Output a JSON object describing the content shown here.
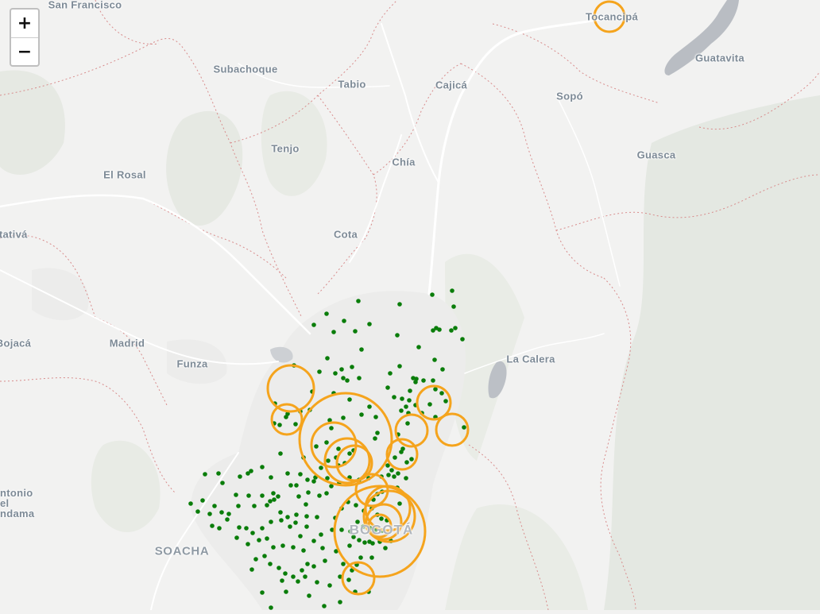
{
  "map": {
    "zoom_in_label": "+",
    "zoom_out_label": "−",
    "colors": {
      "background": "#f2f2f1",
      "terrain": "#e3e7e1",
      "water": "#b9bdc3",
      "road": "#ffffff",
      "boundary": "#d88c8c",
      "point": "#0a7d0a",
      "circle": "#f5a41d"
    },
    "labels": [
      {
        "id": "san-francisco",
        "text": "San Francisco",
        "kind": "town"
      },
      {
        "id": "tocancipa",
        "text": "Tocancipá",
        "kind": "town"
      },
      {
        "id": "guatavita",
        "text": "Guatavita",
        "kind": "town"
      },
      {
        "id": "subachoque",
        "text": "Subachoque",
        "kind": "town"
      },
      {
        "id": "tabio",
        "text": "Tabio",
        "kind": "town"
      },
      {
        "id": "cajica",
        "text": "Cajicá",
        "kind": "town"
      },
      {
        "id": "sopo",
        "text": "Sopó",
        "kind": "town"
      },
      {
        "id": "tenjo",
        "text": "Tenjo",
        "kind": "town"
      },
      {
        "id": "chia",
        "text": "Chía",
        "kind": "town"
      },
      {
        "id": "guasca",
        "text": "Guasca",
        "kind": "town"
      },
      {
        "id": "el-rosal",
        "text": "El Rosal",
        "kind": "town"
      },
      {
        "id": "facatativa",
        "text": "atativá",
        "kind": "town"
      },
      {
        "id": "cota",
        "text": "Cota",
        "kind": "town"
      },
      {
        "id": "bojaca",
        "text": "Bojacá",
        "kind": "town"
      },
      {
        "id": "madrid",
        "text": "Madrid",
        "kind": "town"
      },
      {
        "id": "funza",
        "text": "Funza",
        "kind": "town"
      },
      {
        "id": "la-calera",
        "text": "La Calera",
        "kind": "town"
      },
      {
        "id": "san-antonio",
        "text": "ntonio\nel\nndama",
        "kind": "town"
      },
      {
        "id": "soacha",
        "text": "SOACHA",
        "kind": "city"
      },
      {
        "id": "bogota",
        "text": "BOGOTÁ",
        "kind": "big"
      }
    ]
  }
}
